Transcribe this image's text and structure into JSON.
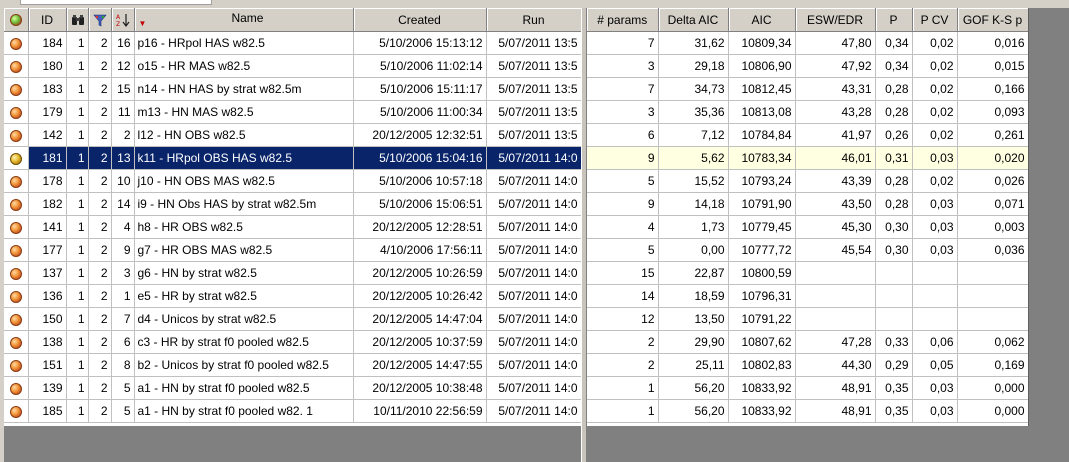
{
  "left_columns": [
    "ID",
    "Name",
    "Created",
    "Run"
  ],
  "right_columns": [
    "# params",
    "Delta AIC",
    "AIC",
    "ESW/EDR",
    "P",
    "P CV",
    "GOF K-S p"
  ],
  "icons": {
    "col1": "status-ball-icon",
    "col3": "binoculars-icon",
    "col4": "filter-icon",
    "col5": "sort-az-icon",
    "sort": "sort-descending-arrow-icon"
  },
  "colors": {
    "selection": "#0a246a",
    "highlight": "#ffffe1"
  },
  "rows": [
    {
      "id": "184",
      "c1": "1",
      "c2": "2",
      "c3": "16",
      "name": "p16 - HRpol HAS w82.5",
      "created": "5/10/2006 15:13:12",
      "run": "5/07/2011 13:5",
      "params": "7",
      "daic": "31,62",
      "aic": "10809,34",
      "esw": "47,80",
      "p": "0,34",
      "pcv": "0,02",
      "gof": "0,016"
    },
    {
      "id": "180",
      "c1": "1",
      "c2": "2",
      "c3": "12",
      "name": "o15 - HR MAS w82.5",
      "created": "5/10/2006 11:02:14",
      "run": "5/07/2011 13:5",
      "params": "3",
      "daic": "29,18",
      "aic": "10806,90",
      "esw": "47,92",
      "p": "0,34",
      "pcv": "0,02",
      "gof": "0,015"
    },
    {
      "id": "183",
      "c1": "1",
      "c2": "2",
      "c3": "15",
      "name": "n14 - HN HAS by strat w82.5m",
      "created": "5/10/2006 15:11:17",
      "run": "5/07/2011 13:5",
      "params": "7",
      "daic": "34,73",
      "aic": "10812,45",
      "esw": "43,31",
      "p": "0,28",
      "pcv": "0,02",
      "gof": "0,166"
    },
    {
      "id": "179",
      "c1": "1",
      "c2": "2",
      "c3": "11",
      "name": "m13 - HN MAS w82.5",
      "created": "5/10/2006 11:00:34",
      "run": "5/07/2011 13:5",
      "params": "3",
      "daic": "35,36",
      "aic": "10813,08",
      "esw": "43,28",
      "p": "0,28",
      "pcv": "0,02",
      "gof": "0,093"
    },
    {
      "id": "142",
      "c1": "1",
      "c2": "2",
      "c3": "2",
      "name": "l12 - HN OBS w82.5",
      "created": "20/12/2005 12:32:51",
      "run": "5/07/2011 13:5",
      "params": "6",
      "daic": "7,12",
      "aic": "10784,84",
      "esw": "41,97",
      "p": "0,26",
      "pcv": "0,02",
      "gof": "0,261"
    },
    {
      "id": "181",
      "c1": "1",
      "c2": "2",
      "c3": "13",
      "name": "k11 - HRpol OBS HAS w82.5",
      "created": "5/10/2006 15:04:16",
      "run": "5/07/2011 14:0",
      "params": "9",
      "daic": "5,62",
      "aic": "10783,34",
      "esw": "46,01",
      "p": "0,31",
      "pcv": "0,03",
      "gof": "0,020"
    },
    {
      "id": "178",
      "c1": "1",
      "c2": "2",
      "c3": "10",
      "name": "j10 - HN OBS MAS w82.5",
      "created": "5/10/2006 10:57:18",
      "run": "5/07/2011 14:0",
      "params": "5",
      "daic": "15,52",
      "aic": "10793,24",
      "esw": "43,39",
      "p": "0,28",
      "pcv": "0,02",
      "gof": "0,026"
    },
    {
      "id": "182",
      "c1": "1",
      "c2": "2",
      "c3": "14",
      "name": "i9 - HN Obs HAS by strat w82.5m",
      "created": "5/10/2006 15:06:51",
      "run": "5/07/2011 14:0",
      "params": "9",
      "daic": "14,18",
      "aic": "10791,90",
      "esw": "43,50",
      "p": "0,28",
      "pcv": "0,03",
      "gof": "0,071"
    },
    {
      "id": "141",
      "c1": "1",
      "c2": "2",
      "c3": "4",
      "name": "h8 - HR OBS w82.5",
      "created": "20/12/2005 12:28:51",
      "run": "5/07/2011 14:0",
      "params": "4",
      "daic": "1,73",
      "aic": "10779,45",
      "esw": "45,30",
      "p": "0,30",
      "pcv": "0,03",
      "gof": "0,003"
    },
    {
      "id": "177",
      "c1": "1",
      "c2": "2",
      "c3": "9",
      "name": "g7 - HR OBS MAS w82.5",
      "created": "4/10/2006 17:56:11",
      "run": "5/07/2011 14:0",
      "params": "5",
      "daic": "0,00",
      "aic": "10777,72",
      "esw": "45,54",
      "p": "0,30",
      "pcv": "0,03",
      "gof": "0,036"
    },
    {
      "id": "137",
      "c1": "1",
      "c2": "2",
      "c3": "3",
      "name": "g6 - HN by strat w82.5",
      "created": "20/12/2005 10:26:59",
      "run": "5/07/2011 14:0",
      "params": "15",
      "daic": "22,87",
      "aic": "10800,59",
      "esw": "",
      "p": "",
      "pcv": "",
      "gof": ""
    },
    {
      "id": "136",
      "c1": "1",
      "c2": "2",
      "c3": "1",
      "name": "e5 - HR by strat w82.5",
      "created": "20/12/2005 10:26:42",
      "run": "5/07/2011 14:0",
      "params": "14",
      "daic": "18,59",
      "aic": "10796,31",
      "esw": "",
      "p": "",
      "pcv": "",
      "gof": ""
    },
    {
      "id": "150",
      "c1": "1",
      "c2": "2",
      "c3": "7",
      "name": "d4 - Unicos by strat w82.5",
      "created": "20/12/2005 14:47:04",
      "run": "5/07/2011 14:0",
      "params": "12",
      "daic": "13,50",
      "aic": "10791,22",
      "esw": "",
      "p": "",
      "pcv": "",
      "gof": ""
    },
    {
      "id": "138",
      "c1": "1",
      "c2": "2",
      "c3": "6",
      "name": "c3 - HR by strat f0 pooled w82.5",
      "created": "20/12/2005 10:37:59",
      "run": "5/07/2011 14:0",
      "params": "2",
      "daic": "29,90",
      "aic": "10807,62",
      "esw": "47,28",
      "p": "0,33",
      "pcv": "0,06",
      "gof": "0,062"
    },
    {
      "id": "151",
      "c1": "1",
      "c2": "2",
      "c3": "8",
      "name": "b2 - Unicos by strat f0 pooled w82.5",
      "created": "20/12/2005 14:47:55",
      "run": "5/07/2011 14:0",
      "params": "2",
      "daic": "25,11",
      "aic": "10802,83",
      "esw": "44,30",
      "p": "0,29",
      "pcv": "0,05",
      "gof": "0,169"
    },
    {
      "id": "139",
      "c1": "1",
      "c2": "2",
      "c3": "5",
      "name": "a1 - HN by strat f0 pooled w82.5",
      "created": "20/12/2005 10:38:48",
      "run": "5/07/2011 14:0",
      "params": "1",
      "daic": "56,20",
      "aic": "10833,92",
      "esw": "48,91",
      "p": "0,35",
      "pcv": "0,03",
      "gof": "0,000"
    },
    {
      "id": "185",
      "c1": "1",
      "c2": "2",
      "c3": "5",
      "name": "a1 - HN by strat f0 pooled w82. 1",
      "created": "10/11/2010 22:56:59",
      "run": "5/07/2011 14:0",
      "params": "1",
      "daic": "56,20",
      "aic": "10833,92",
      "esw": "48,91",
      "p": "0,35",
      "pcv": "0,03",
      "gof": "0,000"
    }
  ],
  "selected_row_index": 5
}
